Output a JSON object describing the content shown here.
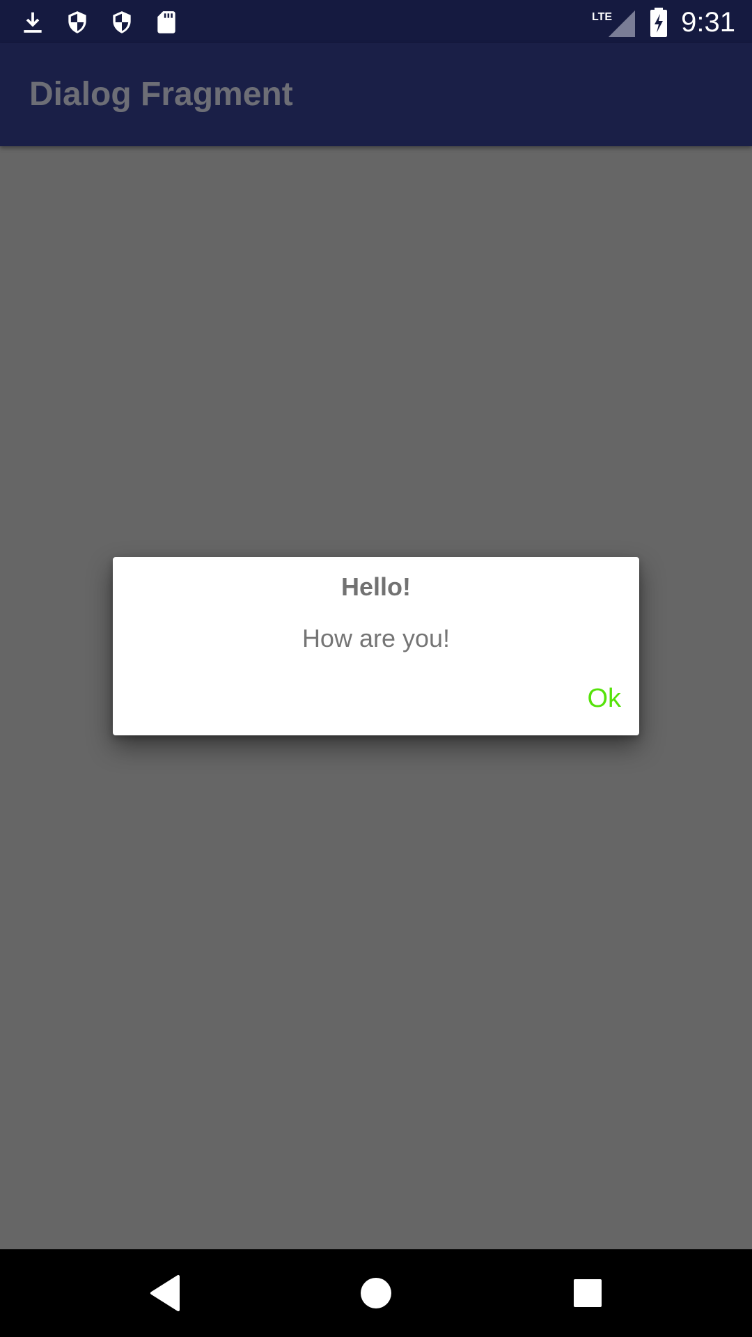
{
  "status_bar": {
    "time": "9:31",
    "network_label": "LTE",
    "left_icons": [
      "download-icon",
      "shield-icon",
      "shield-icon",
      "sd-card-icon"
    ],
    "right_icons": [
      "lte-signal-icon",
      "battery-charging-icon"
    ],
    "background": "#151a40"
  },
  "app_bar": {
    "title": "Dialog Fragment",
    "background": "#1a1f47"
  },
  "dialog": {
    "title": "Hello!",
    "message": "How are you!",
    "ok_label": "Ok",
    "ok_color": "#55e20a"
  },
  "nav_bar": {
    "buttons": [
      "back-icon",
      "home-icon",
      "recents-icon"
    ]
  },
  "scrim_color": "#666666"
}
